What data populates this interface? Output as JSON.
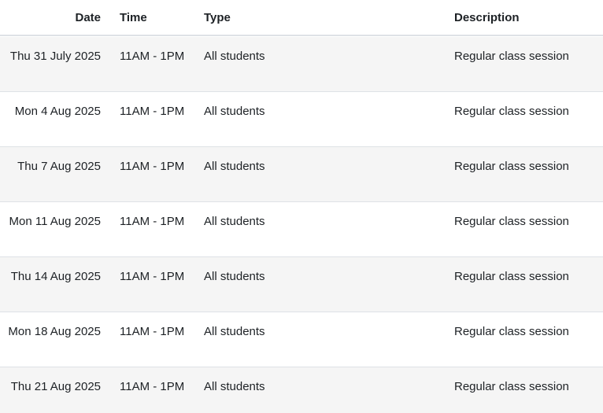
{
  "headers": {
    "date": "Date",
    "time": "Time",
    "type": "Type",
    "description": "Description"
  },
  "rows": [
    {
      "date": "Thu 31 July 2025",
      "time": "11AM - 1PM",
      "type": "All students",
      "description": "Regular class session"
    },
    {
      "date": "Mon 4 Aug 2025",
      "time": "11AM - 1PM",
      "type": "All students",
      "description": "Regular class session"
    },
    {
      "date": "Thu 7 Aug 2025",
      "time": "11AM - 1PM",
      "type": "All students",
      "description": "Regular class session"
    },
    {
      "date": "Mon 11 Aug 2025",
      "time": "11AM - 1PM",
      "type": "All students",
      "description": "Regular class session"
    },
    {
      "date": "Thu 14 Aug 2025",
      "time": "11AM - 1PM",
      "type": "All students",
      "description": "Regular class session"
    },
    {
      "date": "Mon 18 Aug 2025",
      "time": "11AM - 1PM",
      "type": "All students",
      "description": "Regular class session"
    },
    {
      "date": "Thu 21 Aug 2025",
      "time": "11AM - 1PM",
      "type": "All students",
      "description": "Regular class session"
    }
  ]
}
